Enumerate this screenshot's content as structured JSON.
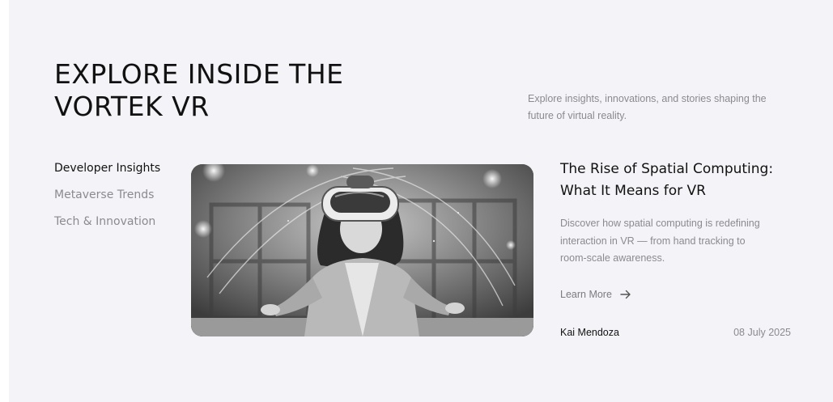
{
  "hero": {
    "title_line1": "EXPLORE INSIDE THE",
    "title_line2": "VORTEK VR",
    "intro": "Explore insights, innovations, and stories shaping the future of virtual reality."
  },
  "categories": [
    {
      "label": "Developer Insights",
      "active": true
    },
    {
      "label": "Metaverse Trends",
      "active": false
    },
    {
      "label": "Tech & Innovation",
      "active": false
    }
  ],
  "article": {
    "title": "The Rise of Spatial Computing: What It Means for VR",
    "description": "Discover how spatial computing is redefining interaction in VR — from hand tracking to room-scale awareness.",
    "learn_more": "Learn More",
    "author": "Kai Mendoza",
    "date": "08 July 2025"
  },
  "colors": {
    "background": "#f4f4f8",
    "text_primary": "#111111",
    "text_muted": "#8a8a8f"
  },
  "icons": {
    "learn_more": "arrow-right-icon"
  }
}
